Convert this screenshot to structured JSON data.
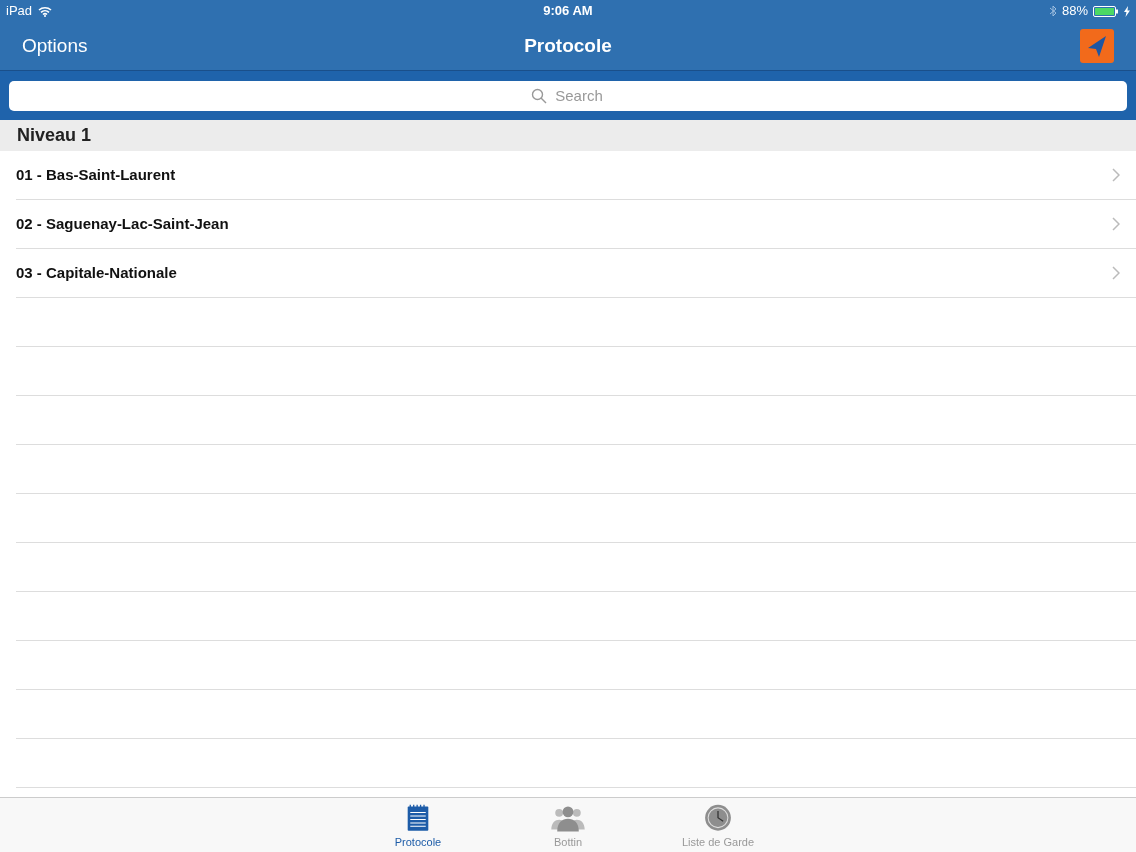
{
  "status_bar": {
    "device": "iPad",
    "time": "9:06 AM",
    "battery": "88%"
  },
  "nav_bar": {
    "left_button": "Options",
    "title": "Protocole"
  },
  "search": {
    "placeholder": "Search"
  },
  "section": {
    "title": "Niveau 1",
    "rows": [
      {
        "label": "01 - Bas-Saint-Laurent"
      },
      {
        "label": "02 - Saguenay-Lac-Saint-Jean"
      },
      {
        "label": "03 - Capitale-Nationale"
      }
    ]
  },
  "tab_bar": [
    {
      "label": "Protocole",
      "kind": "notepad",
      "selected": true
    },
    {
      "label": "Bottin",
      "kind": "people",
      "selected": false
    },
    {
      "label": "Liste de Garde",
      "kind": "clock",
      "selected": false
    }
  ]
}
